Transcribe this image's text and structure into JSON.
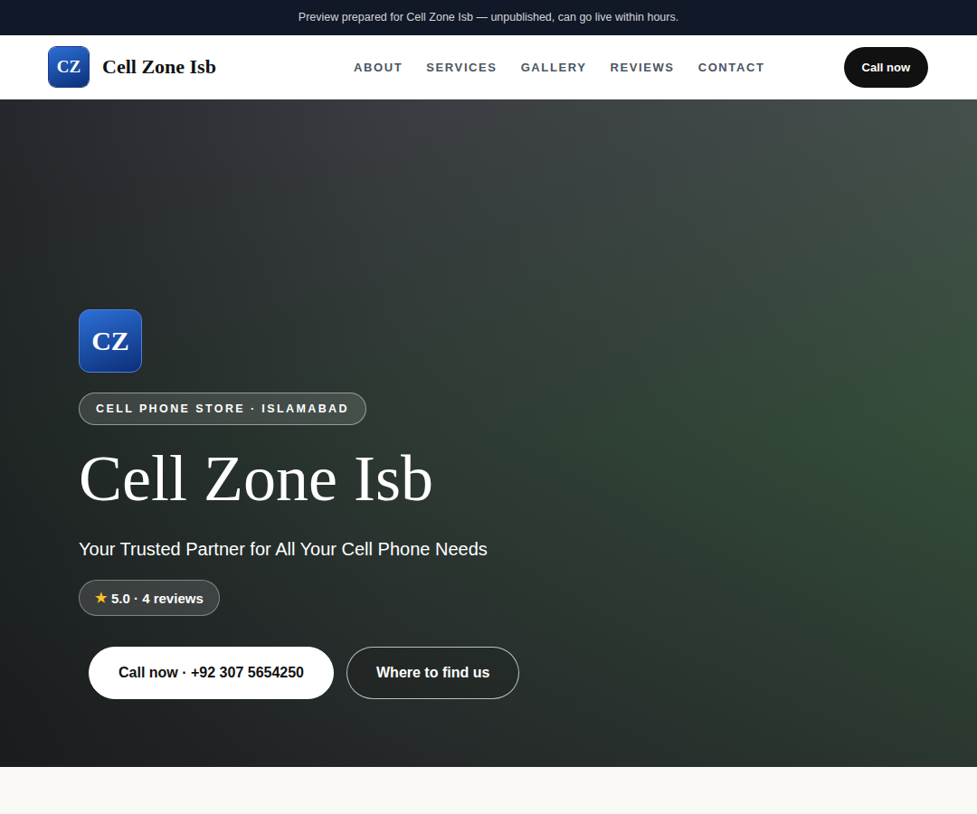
{
  "banner": {
    "text": "Preview prepared for Cell Zone Isb — unpublished, can go live within hours."
  },
  "header": {
    "logo": "CZ",
    "brand": "Cell Zone Isb",
    "nav": [
      {
        "label": "ABOUT"
      },
      {
        "label": "SERVICES"
      },
      {
        "label": "GALLERY"
      },
      {
        "label": "REVIEWS"
      },
      {
        "label": "CONTACT"
      }
    ],
    "button": "Call now"
  },
  "hero": {
    "logo": "CZ",
    "badge": "CELL PHONE STORE · ISLAMABAD",
    "title": "Cell Zone Isb",
    "tagline": "Your Trusted Partner for All Your Cell Phone Needs",
    "rating": {
      "star": "★",
      "text": "5.0 · 4 reviews"
    },
    "buttons": [
      {
        "label": "Call now · +92 307 5654250",
        "kind": "primary"
      },
      {
        "label": "Where to find us",
        "kind": "outline"
      }
    ]
  }
}
